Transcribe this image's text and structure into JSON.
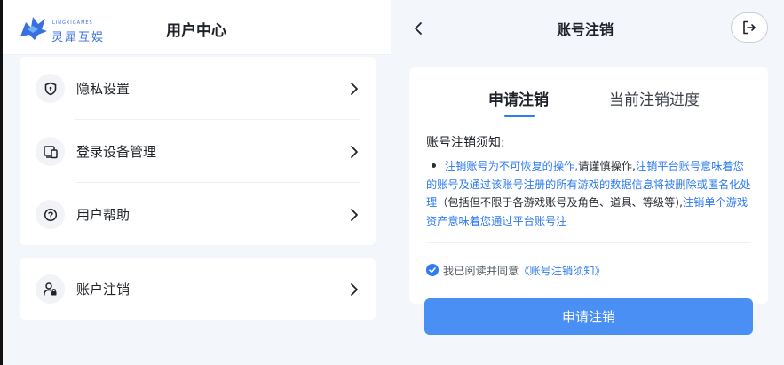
{
  "left_panel": {
    "logo": {
      "text": "灵犀互娱",
      "small_text": "LINGXIGAMES"
    },
    "title": "用户中心",
    "menu": [
      {
        "label": "隐私设置",
        "icon": "shield-icon"
      },
      {
        "label": "登录设备管理",
        "icon": "devices-icon"
      },
      {
        "label": "用户帮助",
        "icon": "help-icon"
      }
    ],
    "account_item": {
      "label": "账户注销",
      "icon": "user-lock-icon"
    }
  },
  "right_panel": {
    "title": "账号注销",
    "tabs": [
      {
        "label": "申请注销",
        "active": true
      },
      {
        "label": "当前注销进度",
        "active": false
      }
    ],
    "notice": {
      "title": "账号注销须知:",
      "segments": [
        {
          "text": "注销账号为不可恢复的操作,",
          "emphasis": true
        },
        {
          "text": "请谨慎操作,",
          "emphasis": false
        },
        {
          "text": "注销平台账号意味着您的账号及通过该账号注册的所有游戏的数据信息将被删除或匿名化处理",
          "emphasis": true
        },
        {
          "text": "（包括但不限于各游戏账号及角色、道具、等级等),",
          "emphasis": false
        },
        {
          "text": "注销单个游戏资产意味着您通过平台账号注",
          "emphasis": true
        }
      ]
    },
    "agree": {
      "checked": true,
      "text": "我已阅读并同意",
      "link": "《账号注销须知》"
    },
    "submit_label": "申请注销"
  },
  "colors": {
    "accent": "#2f7bf0",
    "button": "#4a8ff3",
    "background": "#f3f6fb"
  }
}
